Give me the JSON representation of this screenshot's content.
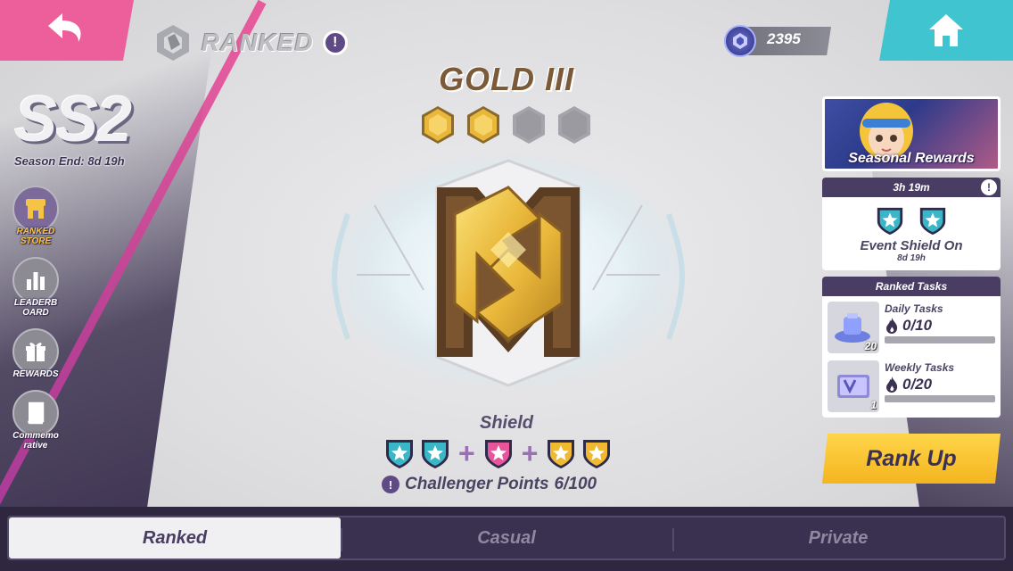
{
  "header": {
    "mode_title": "RANKED",
    "currency_value": "2395"
  },
  "season": {
    "label": "SS2",
    "end_text": "Season End: 8d 19h"
  },
  "side_menu": {
    "items": [
      {
        "label": "RANKED STORE",
        "icon": "store-icon",
        "active": true
      },
      {
        "label": "LEADERB OARD",
        "icon": "leaderboard-icon",
        "active": false
      },
      {
        "label": "REWARDS",
        "icon": "gift-icon",
        "active": false
      },
      {
        "label": "Commemo rative",
        "icon": "book-icon",
        "active": false
      }
    ]
  },
  "rank": {
    "name": "GOLD III",
    "stars_filled": 2,
    "stars_total": 4,
    "shield_label": "Shield",
    "challenger_label": "Challenger Points",
    "challenger_value": "6/100"
  },
  "right_panel": {
    "rewards_label": "Seasonal Rewards",
    "event_timer": "3h 19m",
    "event_title": "Event Shield On",
    "event_sub": "8d 19h",
    "tasks_header": "Ranked Tasks",
    "tasks": [
      {
        "name": "Daily Tasks",
        "progress": "0/10",
        "count": "20"
      },
      {
        "name": "Weekly Tasks",
        "progress": "0/20",
        "count": "1"
      }
    ],
    "rank_up_label": "Rank Up"
  },
  "tabs": [
    {
      "label": "Ranked",
      "active": true
    },
    {
      "label": "Casual",
      "active": false
    },
    {
      "label": "Private",
      "active": false
    }
  ],
  "colors": {
    "back_button": "#ec5f9a",
    "home_button": "#40c4cf",
    "gold": "#e9b73a",
    "panel_dark": "#4a3d63",
    "rank_up": "#f6c445"
  }
}
